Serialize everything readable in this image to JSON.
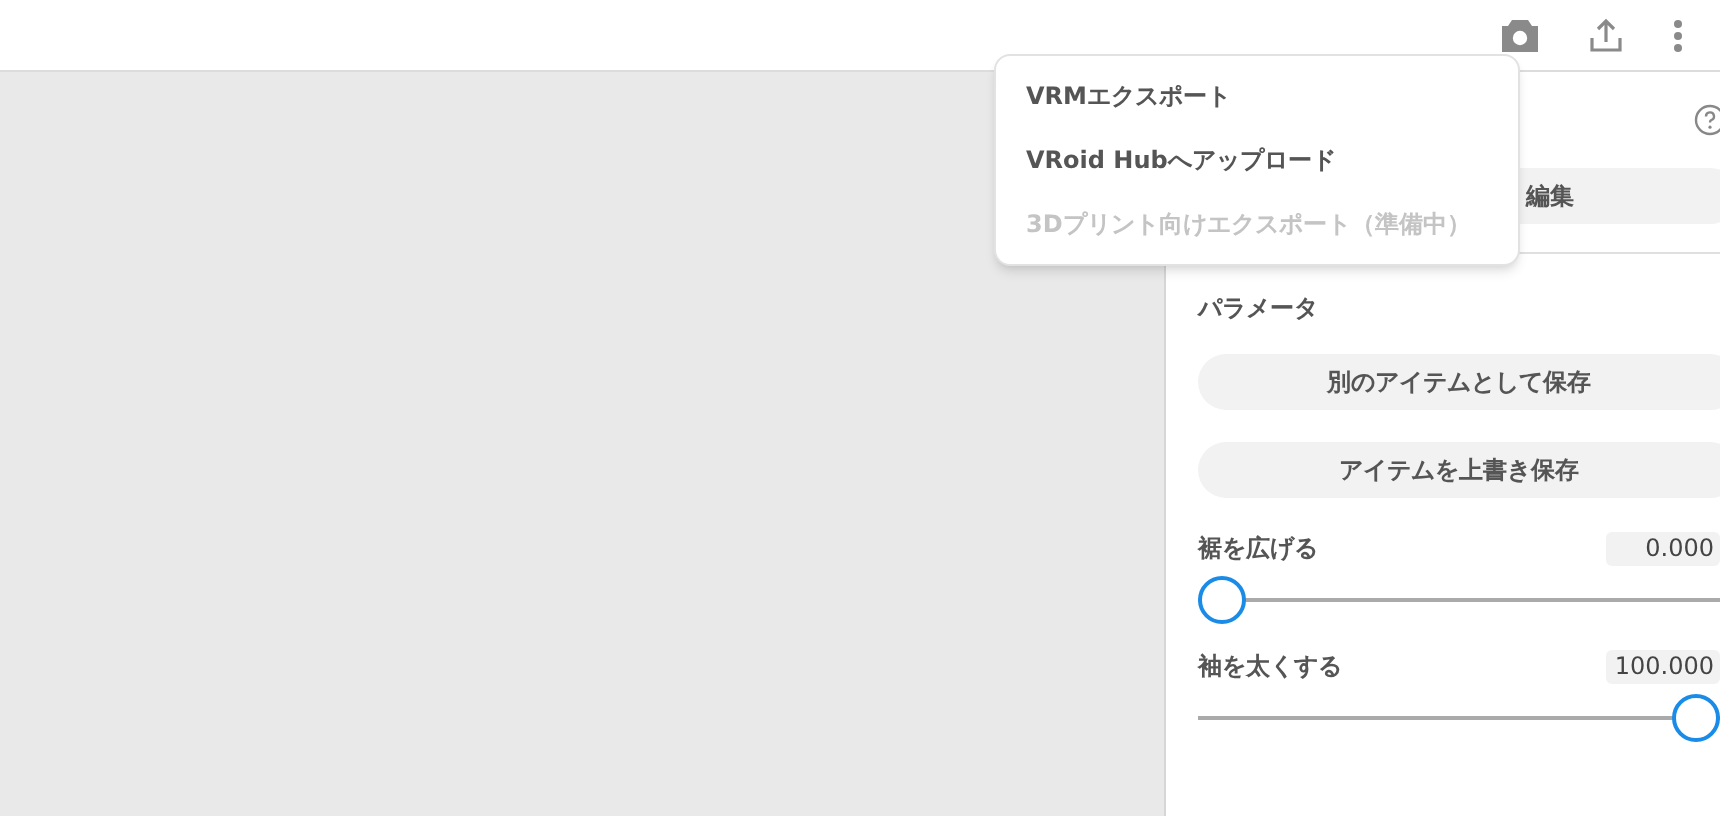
{
  "toolbar": {
    "buttons": [
      {
        "kind": "camera"
      },
      {
        "kind": "share"
      },
      {
        "kind": "more"
      }
    ]
  },
  "menu": {
    "items": [
      {
        "label": "VRMエクスポート",
        "disabled": false
      },
      {
        "label": "VRoid Hubへアップロード",
        "disabled": false
      },
      {
        "label": "3Dプリント向けエクスポート（準備中）",
        "disabled": true
      }
    ]
  },
  "panel": {
    "edit_button": "編集",
    "section_title": "パラメータ",
    "buttons": [
      "別のアイテムとして保存",
      "アイテムを上書き保存"
    ],
    "sliders": [
      {
        "label": "裾を広げる",
        "reading": "0.000",
        "level": 0
      },
      {
        "label": "袖を太くする",
        "reading": "100.000",
        "level": 1
      }
    ]
  }
}
